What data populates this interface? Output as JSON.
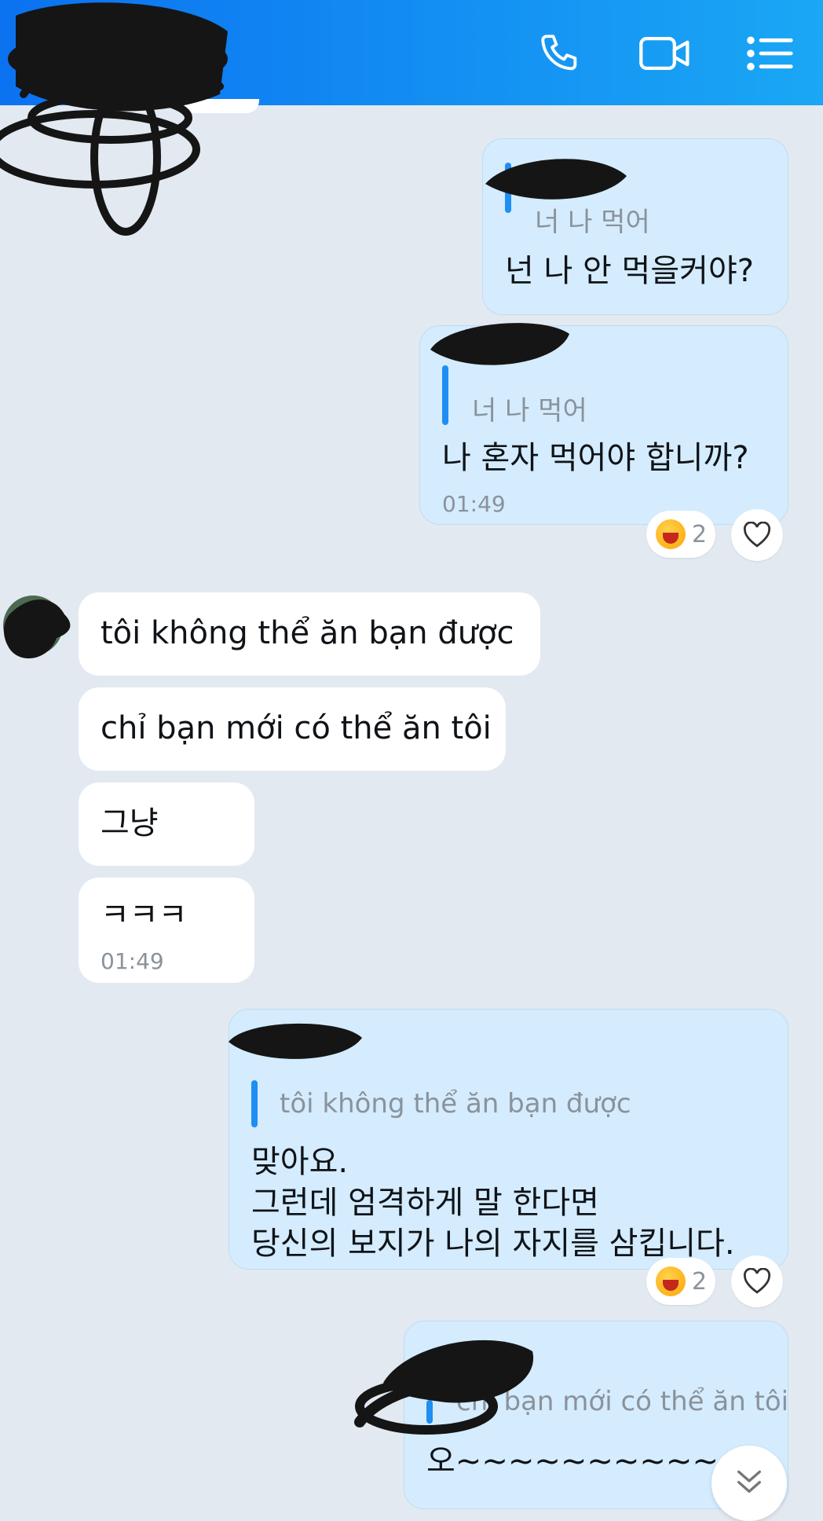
{
  "header": {
    "icons": [
      "phone-icon",
      "video-icon",
      "menu-list-icon"
    ],
    "colors": {
      "gradient_start": "#0b72f0",
      "gradient_end": "#1aa7f5"
    }
  },
  "messages": [
    {
      "direction": "outgoing",
      "quote": "너 나 먹어",
      "text": "넌 나 안 먹을커야?"
    },
    {
      "direction": "outgoing",
      "quote": "너 나 먹어",
      "text": "나 혼자 먹어야 합니까?",
      "time": "01:49",
      "reaction_count": "2"
    },
    {
      "direction": "incoming",
      "text": "tôi không thể ăn bạn được"
    },
    {
      "direction": "incoming",
      "text": "chỉ bạn mới có thể ăn tôi"
    },
    {
      "direction": "incoming",
      "text": "그냥"
    },
    {
      "direction": "incoming",
      "text": "ㅋㅋㅋ",
      "time": "01:49"
    },
    {
      "direction": "outgoing",
      "quote": "tôi không thể ăn bạn được",
      "lines": [
        "맞아요.",
        "그런데 엄격하게 말 한다면",
        "당신의 보지가 나의 자지를 삼킵니다."
      ],
      "reaction_count": "2"
    },
    {
      "direction": "outgoing",
      "quote": "chỉ bạn mới có thể ăn tôi",
      "text": "오~~~~~~~~~~~"
    }
  ],
  "colors": {
    "background": "#e2e9f1",
    "outgoing_bubble": "#d4ecfd",
    "incoming_bubble": "#ffffff",
    "quote_bar": "#1e8ef3",
    "secondary_text": "#8a929b"
  }
}
